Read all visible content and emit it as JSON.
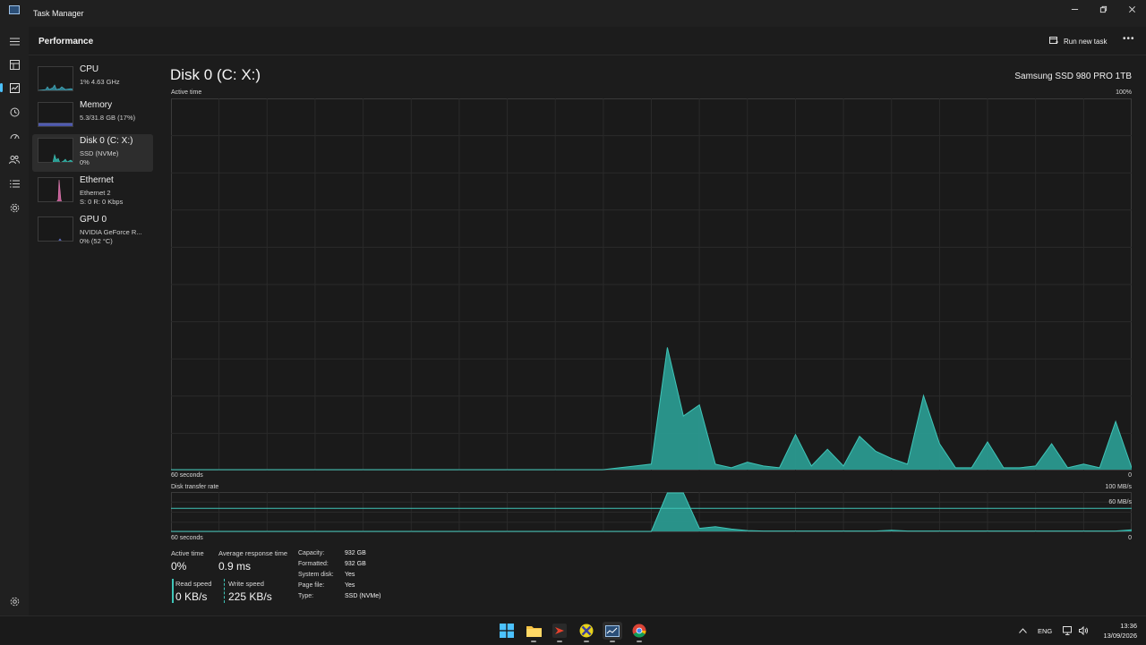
{
  "window": {
    "title": "Task Manager"
  },
  "header": {
    "page_title": "Performance",
    "run_task_label": "Run new task"
  },
  "sidebar": {
    "items": [
      {
        "title": "CPU",
        "line1": "1% 4.63 GHz",
        "line2": "",
        "color": "#4ab5c9"
      },
      {
        "title": "Memory",
        "line1": "5.3/31.8 GB (17%)",
        "line2": "",
        "color": "#7a86d8"
      },
      {
        "title": "Disk 0 (C: X:)",
        "line1": "SSD (NVMe)",
        "line2": "0%",
        "color": "#3fb5a3"
      },
      {
        "title": "Ethernet",
        "line1": "Ethernet 2",
        "line2": "S: 0 R: 0 Kbps",
        "color": "#e37fb5"
      },
      {
        "title": "GPU 0",
        "line1": "NVIDIA GeForce R...",
        "line2": "0% (52 °C)",
        "color": "#6b7bd8"
      }
    ]
  },
  "main": {
    "disk_title": "Disk 0 (C: X:)",
    "model": "Samsung SSD 980 PRO 1TB",
    "active_chart": {
      "label": "Active time",
      "max_label": "100%",
      "time_label": "60 seconds",
      "min_label": "0"
    },
    "transfer_chart": {
      "label": "Disk transfer rate",
      "max_label": "100 MB/s",
      "mid_label": "60 MB/s",
      "time_label": "60 seconds",
      "min_label": "0"
    },
    "stats": {
      "active_time_label": "Active time",
      "active_time_value": "0%",
      "avg_response_label": "Average response time",
      "avg_response_value": "0.9 ms",
      "read_label": "Read speed",
      "read_value": "0 KB/s",
      "write_label": "Write speed",
      "write_value": "225 KB/s"
    },
    "properties": [
      {
        "key": "Capacity:",
        "value": "932 GB"
      },
      {
        "key": "Formatted:",
        "value": "932 GB"
      },
      {
        "key": "System disk:",
        "value": "Yes"
      },
      {
        "key": "Page file:",
        "value": "Yes"
      },
      {
        "key": "Type:",
        "value": "SSD (NVMe)"
      }
    ]
  },
  "chart_data": [
    {
      "type": "area",
      "title": "Active time",
      "y_unit": "%",
      "ylim": [
        0,
        100
      ],
      "x": [
        0,
        1,
        2,
        3,
        4,
        5,
        6,
        7,
        8,
        9,
        10,
        11,
        12,
        13,
        14,
        15,
        16,
        17,
        18,
        19,
        20,
        21,
        22,
        23,
        24,
        25,
        26,
        27,
        28,
        29,
        30,
        31,
        32,
        33,
        34,
        35,
        36,
        37,
        38,
        39,
        40,
        41,
        42,
        43,
        44,
        45,
        46,
        47,
        48,
        49,
        50,
        51,
        52,
        53,
        54,
        55,
        56,
        57,
        58,
        59,
        60
      ],
      "values": [
        0,
        0,
        0,
        0,
        0,
        0,
        0,
        0,
        0,
        0,
        0,
        0,
        0,
        0,
        0,
        0,
        0,
        0,
        0,
        0,
        0,
        0,
        0,
        0,
        0,
        0,
        0,
        0,
        0.5,
        1,
        1.5,
        33,
        14.5,
        17.5,
        1.5,
        0.5,
        2,
        1,
        0.5,
        9.5,
        1,
        5.5,
        1,
        9,
        5,
        3,
        1.5,
        20,
        7,
        0.5,
        0.5,
        7.5,
        0.5,
        0.5,
        1,
        7,
        0.5,
        1.5,
        0.5,
        13,
        0.5
      ],
      "grid": true
    },
    {
      "type": "area",
      "title": "Disk transfer rate",
      "y_unit": "MB/s",
      "ylim": [
        0,
        100
      ],
      "x": [
        0,
        1,
        2,
        3,
        4,
        5,
        6,
        7,
        8,
        9,
        10,
        11,
        12,
        13,
        14,
        15,
        16,
        17,
        18,
        19,
        20,
        21,
        22,
        23,
        24,
        25,
        26,
        27,
        28,
        29,
        30,
        31,
        32,
        33,
        34,
        35,
        36,
        37,
        38,
        39,
        40,
        41,
        42,
        43,
        44,
        45,
        46,
        47,
        48,
        49,
        50,
        51,
        52,
        53,
        54,
        55,
        56,
        57,
        58,
        59,
        60
      ],
      "values": [
        0,
        0,
        0,
        0,
        0,
        0,
        0,
        0,
        0,
        0,
        0,
        0,
        0,
        0,
        0,
        0,
        0,
        0,
        0,
        0,
        0,
        0,
        0,
        0,
        0,
        0,
        0,
        0,
        0,
        0,
        0,
        100,
        100,
        8,
        12,
        6,
        2,
        1,
        1,
        1,
        1,
        1,
        1,
        1,
        1,
        3,
        1,
        1,
        1,
        1,
        1,
        1,
        1,
        1,
        1,
        1,
        1,
        1,
        1,
        1,
        4
      ],
      "reference_lines": [
        {
          "label": "60 MB/s",
          "value": 60
        }
      ],
      "grid": true
    }
  ],
  "taskbar": {
    "tray": {
      "language": "ENG",
      "time": "13:36",
      "date": "13/09/2026"
    }
  },
  "colors": {
    "accent": "#4cc2ff",
    "disk_fill": "#2a9c93",
    "disk_line": "#3fc5b8"
  }
}
